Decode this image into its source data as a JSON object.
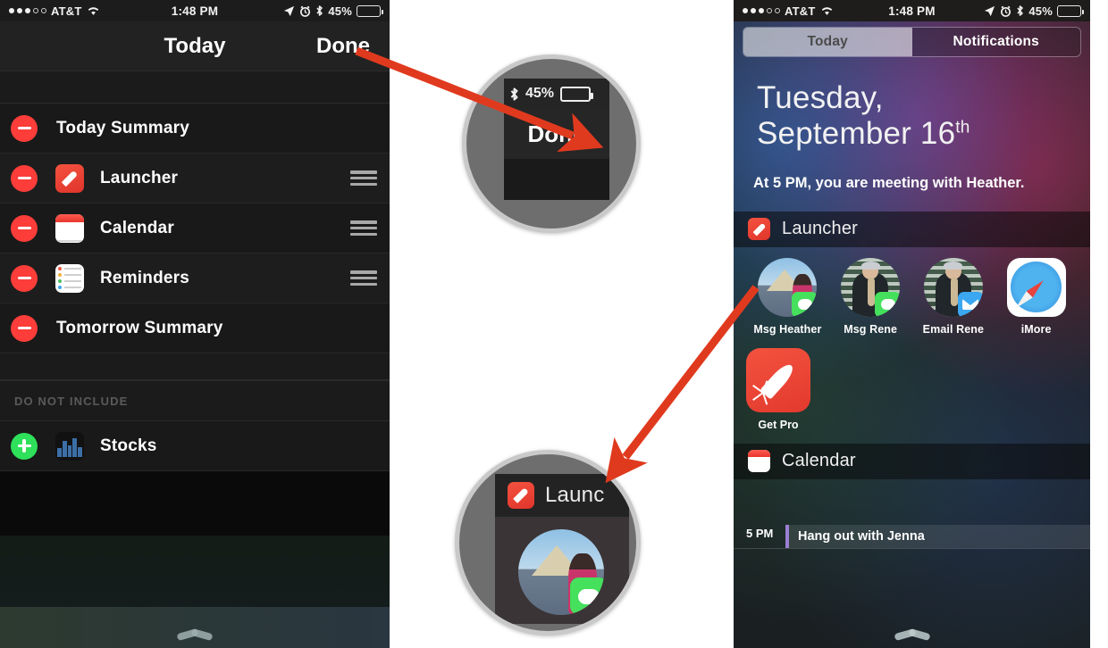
{
  "colors": {
    "accent_red": "#fc3d39",
    "accent_green": "#2ee05a",
    "arrow_red": "#e03a1e",
    "magnifier_ring": "#c9c9c9"
  },
  "left_phone": {
    "status_bar": {
      "signal_dots_filled": 3,
      "signal_dots_empty": 2,
      "carrier": "AT&T",
      "wifi_icon": "wifi-icon",
      "time": "1:48 PM",
      "location_icon": "location-arrow-icon",
      "alarm_icon": "alarm-clock-icon",
      "bluetooth_icon": "bluetooth-icon",
      "battery_percent": "45%",
      "battery_level": 45
    },
    "navbar": {
      "title": "Today",
      "done_label": "Done"
    },
    "include_rows": [
      {
        "label": "Today Summary",
        "badge": "remove",
        "icon": null,
        "drag": false
      },
      {
        "label": "Launcher",
        "badge": "remove",
        "icon": "launcher",
        "drag": true
      },
      {
        "label": "Calendar",
        "badge": "remove",
        "icon": "calendar",
        "drag": true
      },
      {
        "label": "Reminders",
        "badge": "remove",
        "icon": "reminders",
        "drag": true
      },
      {
        "label": "Tomorrow Summary",
        "badge": "remove",
        "icon": null,
        "drag": false
      }
    ],
    "section_header": "DO NOT INCLUDE",
    "exclude_rows": [
      {
        "label": "Stocks",
        "badge": "add",
        "icon": "stocks",
        "drag": false
      }
    ]
  },
  "right_phone": {
    "status_bar": {
      "signal_dots_filled": 3,
      "signal_dots_empty": 2,
      "carrier": "AT&T",
      "wifi_icon": "wifi-icon",
      "time": "1:48 PM",
      "location_icon": "location-arrow-icon",
      "alarm_icon": "alarm-clock-icon",
      "bluetooth_icon": "bluetooth-icon",
      "battery_percent": "45%",
      "battery_level": 45
    },
    "tabs": [
      {
        "label": "Today",
        "active": true
      },
      {
        "label": "Notifications",
        "active": false
      }
    ],
    "date_line_1": "Tuesday,",
    "date_line_2": "September 16",
    "date_ordinal": "th",
    "summary": "At 5 PM, you are meeting with Heather.",
    "launcher_widget": {
      "title": "Launcher",
      "icon": "launcher-icon",
      "shortcuts": [
        {
          "caption": "Msg Heather",
          "art": "photo-louvre",
          "overlay": "messages-icon"
        },
        {
          "caption": "Msg Rene",
          "art": "photo-rene",
          "overlay": "messages-icon"
        },
        {
          "caption": "Email Rene",
          "art": "photo-rene",
          "overlay": "mail-icon"
        },
        {
          "caption": "iMore",
          "art": "safari-icon",
          "overlay": null
        }
      ],
      "promo": {
        "caption": "Get Pro",
        "icon": "rocket-icon"
      }
    },
    "calendar_widget": {
      "title": "Calendar",
      "icon": "calendar-icon",
      "events": [
        {
          "time": "5 PM",
          "title": "Hang out with Jenna"
        }
      ]
    }
  },
  "callouts": {
    "done_magnifier": {
      "bluetooth_icon": "bluetooth-icon",
      "battery_percent": "45%",
      "battery_level": 45,
      "button_label": "Done"
    },
    "launcher_magnifier": {
      "widget_icon": "launcher-icon",
      "widget_label": "Launc"
    }
  }
}
